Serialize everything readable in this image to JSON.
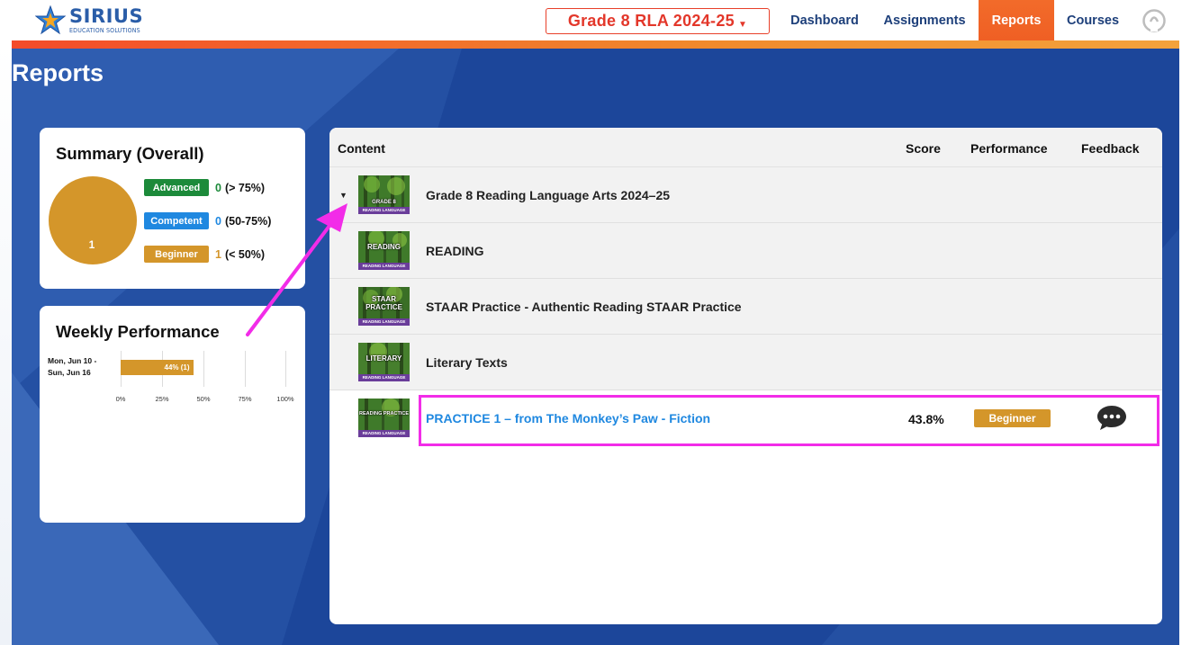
{
  "header": {
    "logo_name": "SIRIUS",
    "logo_sub": "EDUCATION SOLUTIONS",
    "course_selector": "Grade 8 RLA 2024-25",
    "nav": [
      {
        "label": "Dashboard",
        "active": false
      },
      {
        "label": "Assignments",
        "active": false
      },
      {
        "label": "Reports",
        "active": true
      },
      {
        "label": "Courses",
        "active": false
      }
    ]
  },
  "page_title": "Reports",
  "summary": {
    "title": "Summary (Overall)",
    "pie_label": "1",
    "legend": [
      {
        "label": "Advanced",
        "count": "0",
        "range": "(> 75%)",
        "color": "#1c8a3a"
      },
      {
        "label": "Competent",
        "count": "0",
        "range": "(50-75%)",
        "color": "#1f88e0"
      },
      {
        "label": "Beginner",
        "count": "1",
        "range": "(< 50%)",
        "color": "#d4962a"
      }
    ]
  },
  "weekly": {
    "title": "Weekly Performance",
    "week_label_1": "Mon, Jun 10 -",
    "week_label_2": "Sun, Jun 16",
    "bar_label": "44% (1)",
    "bar_value": 44,
    "ticks": [
      "0%",
      "25%",
      "50%",
      "75%",
      "100%"
    ]
  },
  "table": {
    "headers": {
      "content": "Content",
      "score": "Score",
      "performance": "Performance",
      "feedback": "Feedback"
    },
    "rows": [
      {
        "title": "Grade 8 Reading Language Arts 2024–25",
        "thumb_label": "GRADE 8",
        "thumb_band": "READING LANGUAGE ARTS",
        "expanded": true
      },
      {
        "title": "READING",
        "thumb_label": "READING",
        "thumb_band": "READING LANGUAGE ARTS"
      },
      {
        "title": "STAAR Practice - Authentic Reading STAAR Practice",
        "thumb_label": "STAAR PRACTICE",
        "thumb_band": "READING LANGUAGE ARTS"
      },
      {
        "title": "Literary Texts",
        "thumb_label": "LITERARY",
        "thumb_band": "READING LANGUAGE ARTS"
      },
      {
        "title": "PRACTICE 1 – from The Monkey’s Paw - Fiction",
        "thumb_label": "READING PRACTICE",
        "thumb_band": "READING LANGUAGE ARTS",
        "score": "43.8%",
        "performance": "Beginner"
      }
    ]
  },
  "colors": {
    "brand_blue": "#2a5da8",
    "accent_orange": "#f26b2a",
    "highlight_magenta": "#f22ce8",
    "background_blue": "#2450a3"
  }
}
